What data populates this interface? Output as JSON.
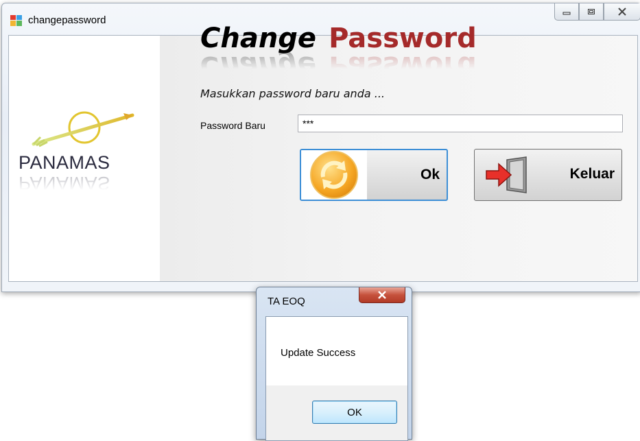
{
  "window": {
    "title": "changepassword",
    "icon": "app-form-icon",
    "controls": [
      "minimize-icon",
      "restore-icon",
      "close-icon"
    ]
  },
  "logo": {
    "text": "PANAMAS",
    "icon": "arrow-ring-logo-icon"
  },
  "form": {
    "heading_word1": "Change",
    "heading_word2": "Password",
    "heading_color1": "#000000",
    "heading_color2": "#a52a2a",
    "subtitle": "Masukkan password baru anda ...",
    "password_label": "Password Baru",
    "password_value": "***"
  },
  "buttons": {
    "ok_label": "Ok",
    "ok_icon": "refresh-icon",
    "keluar_label": "Keluar",
    "keluar_icon": "exit-door-icon"
  },
  "dialog": {
    "title": "TA EOQ",
    "message": "Update Success",
    "ok_label": "OK",
    "close_icon": "close-icon"
  }
}
